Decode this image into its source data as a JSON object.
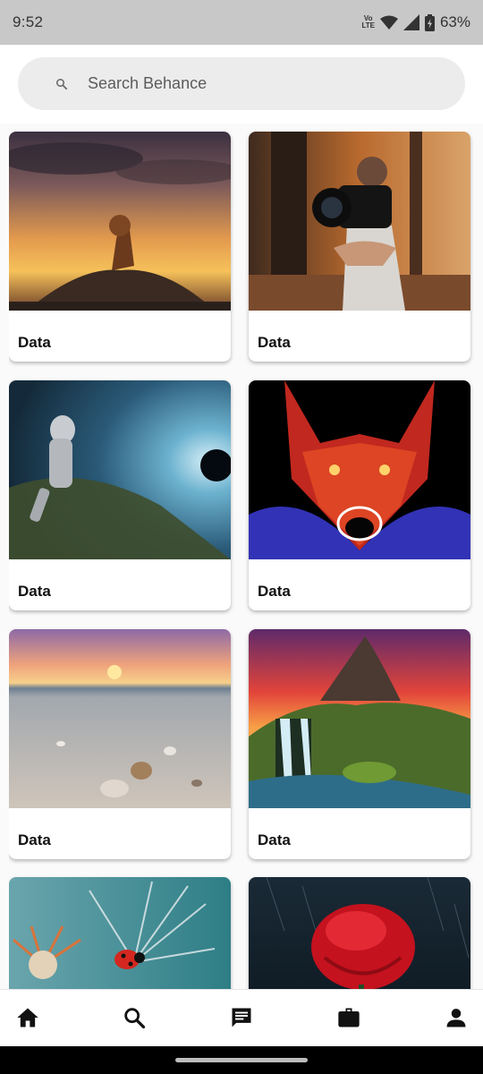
{
  "status_bar": {
    "time": "9:52",
    "network_top": "Vo",
    "network_bottom": "LTE",
    "battery": "63%"
  },
  "search": {
    "placeholder": "Search Behance",
    "value": ""
  },
  "cards": [
    {
      "label": "Data",
      "image": "lion-on-rocks-sunset"
    },
    {
      "label": "Data",
      "image": "man-holding-camera-forest"
    },
    {
      "label": "Data",
      "image": "astronaut-space-vortex"
    },
    {
      "label": "Data",
      "image": "neon-fractal-wolf"
    },
    {
      "label": "Data",
      "image": "beach-shells-sunset"
    },
    {
      "label": "Data",
      "image": "waterfall-mountain-sunset"
    },
    {
      "label": "",
      "image": "ladybug-dandelion"
    },
    {
      "label": "",
      "image": "red-rose-rain"
    }
  ],
  "bottom_nav": [
    {
      "icon": "home-icon"
    },
    {
      "icon": "search-icon"
    },
    {
      "icon": "message-icon"
    },
    {
      "icon": "briefcase-icon"
    },
    {
      "icon": "person-icon"
    }
  ]
}
